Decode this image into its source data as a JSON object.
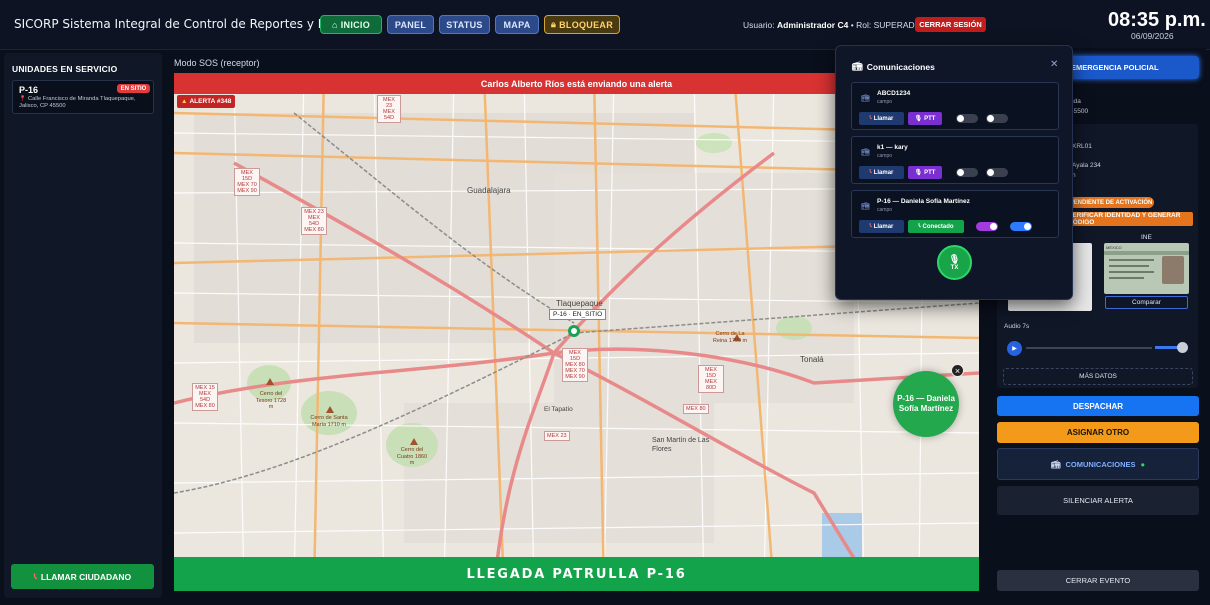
{
  "app": {
    "title": "SICORP Sistema Integral de Control de Reportes y Patrullaje"
  },
  "nav": {
    "inicio": "INICIO",
    "panel": "PANEL",
    "status": "STATUS",
    "mapa": "MAPA",
    "bloquear": "BLOQUEAR"
  },
  "user": {
    "label": "Usuario:",
    "name": "Administrador C4",
    "role_label": "• Rol:",
    "role": "SUPERADMIN",
    "logout": "CERRAR SESIÓN"
  },
  "clock": {
    "time": "08:35 p.m.",
    "date": "06/09/2026"
  },
  "units": {
    "title": "UNIDADES EN SERVICIO",
    "items": [
      {
        "name": "P-16",
        "status": "EN SITIO",
        "address": "Calle Francisco de Miranda Tlaquepaque, Jalisco, CP 45500"
      }
    ],
    "call_button": "LLAMAR CIUDADANO"
  },
  "map": {
    "mode": "Modo SOS (receptor)",
    "alert_banner": "Carlos Alberto Ríos está enviando una alerta",
    "alert_badge": "ALERTA #348",
    "arrival": "LLEGADA PATRULLA P-16",
    "unit_tag": "P-16 · EN_SITIO",
    "bubble": "P-16 — Daniela Sofía Martínez",
    "places": {
      "guadalajara": "Guadalajara",
      "tlaquepaque": "Tlaquepaque",
      "tonala": "Tonalá",
      "tapatio": "El Tapatío",
      "sanmartin": "San Martín de Las Flores"
    },
    "highways": {
      "h1": "MEX 15D MEX 70 MEX 90",
      "h2": "MEX 23 MEX 54D MEX 80",
      "h3": "MEX 23 MEX 54D",
      "h4": "MEX 15D MEX 80 MEX 70 MEX 90",
      "h5": "MEX 15D MEX 80D",
      "h6": "MEX 15 MEX 54D MEX 80",
      "h7": "MEX 23",
      "h8": "MEX 80"
    },
    "peaks": {
      "p1": "Cerro del Tesoro 1728 m",
      "p2": "Cerro de Santa María 1710 m",
      "p3": "Cerro del Cuatro 1860 m",
      "p4": "Cerro de La Reina 1700 m"
    }
  },
  "right": {
    "emergency": "EMERGENCIA POLICIAL",
    "snippet1": "nda",
    "snippet2": "45500",
    "snippet3": "XRL01",
    "snippet4": "Ayala 234",
    "snippet5": "n",
    "pending": "PENDIENTE DE ACTIVACIÓN",
    "verify": "VERIFICAR IDENTIDAD Y GENERAR CÓDIGO",
    "ine_label": "INE",
    "ine_card": "MÉXICO",
    "compare": "Comparar",
    "audio": "Audio 7s",
    "more": "MÁS DATOS",
    "dispatch": "DESPACHAR",
    "assign": "ASIGNAR OTRO",
    "comms": "COMUNICACIONES",
    "silence": "SILENCIAR ALERTA",
    "close": "CERRAR EVENTO"
  },
  "commpanel": {
    "title": "Comunicaciones",
    "contacts": [
      {
        "name": "ABCD1234",
        "sub": "campo",
        "call": "Llamar",
        "action": "PTT"
      },
      {
        "name": "k1 — kary",
        "sub": "campo",
        "call": "Llamar",
        "action": "PTT"
      },
      {
        "name": "P-16 — Daniela Sofía Martínez",
        "sub": "campo",
        "call": "Llamar",
        "action": "Conectado"
      }
    ],
    "tx": "TX"
  },
  "colors": {
    "accent": "#1673f2",
    "danger": "#d83232",
    "success": "#13a34a",
    "warning": "#f39a1a",
    "background": "#0a0f1c"
  }
}
